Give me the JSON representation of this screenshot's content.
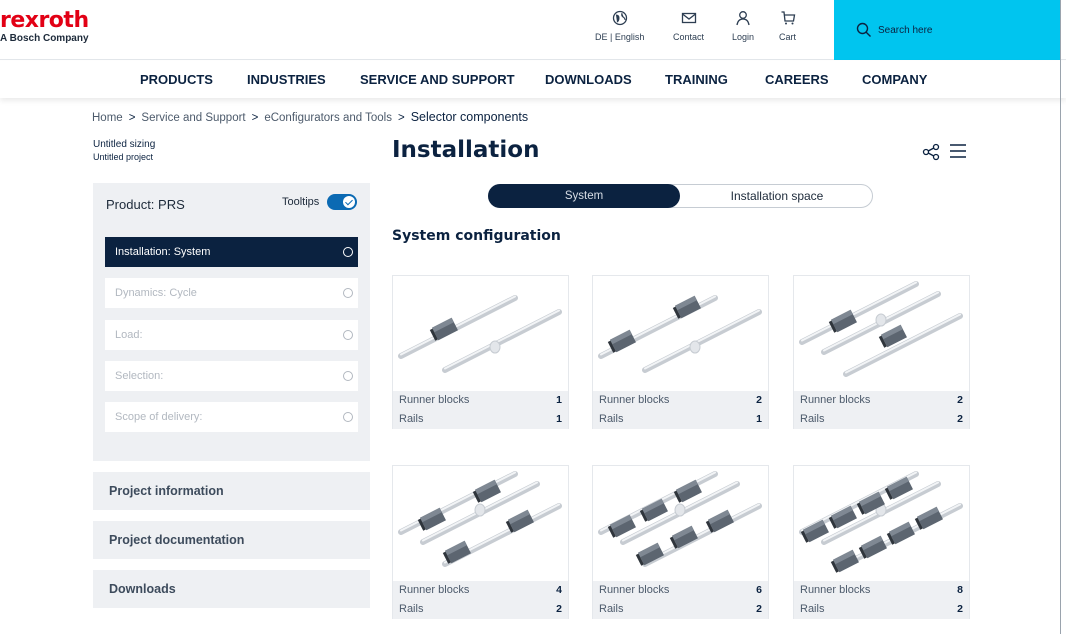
{
  "brand": {
    "logo": "rexroth",
    "tagline": "A Bosch Company"
  },
  "utility_nav": [
    {
      "label": "DE | English",
      "icon": "globe-icon"
    },
    {
      "label": "Contact",
      "icon": "envelope-icon"
    },
    {
      "label": "Login",
      "icon": "user-icon"
    },
    {
      "label": "Cart",
      "icon": "cart-icon"
    }
  ],
  "search": {
    "placeholder": "Search here"
  },
  "main_nav": [
    "PRODUCTS",
    "INDUSTRIES",
    "SERVICE AND SUPPORT",
    "DOWNLOADS",
    "TRAINING",
    "CAREERS",
    "COMPANY"
  ],
  "breadcrumb": [
    "Home",
    "Service and Support",
    "eConfigurators and Tools",
    "Selector components"
  ],
  "sizing": {
    "name": "Untitled sizing",
    "project": "Untitled project"
  },
  "page_title": "Installation",
  "panel": {
    "product": "Product: PRS",
    "tooltips_label": "Tooltips",
    "tooltips_on": true,
    "steps": [
      {
        "label": "Installation:  System",
        "active": true
      },
      {
        "label": "Dynamics:  Cycle",
        "active": false
      },
      {
        "label": "Load:",
        "active": false
      },
      {
        "label": "Selection:",
        "active": false
      },
      {
        "label": "Scope of delivery:",
        "active": false
      }
    ]
  },
  "accordions": [
    "Project information",
    "Project documentation",
    "Downloads"
  ],
  "tabs": {
    "active": "System",
    "inactive": "Installation space"
  },
  "section_title": "System configuration",
  "configs": [
    {
      "runner_label": "Runner blocks",
      "runner_blocks": "1",
      "rails_label": "Rails",
      "rails": "1"
    },
    {
      "runner_label": "Runner blocks",
      "runner_blocks": "2",
      "rails_label": "Rails",
      "rails": "1"
    },
    {
      "runner_label": "Runner blocks",
      "runner_blocks": "2",
      "rails_label": "Rails",
      "rails": "2"
    },
    {
      "runner_label": "Runner blocks",
      "runner_blocks": "4",
      "rails_label": "Rails",
      "rails": "2"
    },
    {
      "runner_label": "Runner blocks",
      "runner_blocks": "6",
      "rails_label": "Rails",
      "rails": "2"
    },
    {
      "runner_label": "Runner blocks",
      "runner_blocks": "8",
      "rails_label": "Rails",
      "rails": "2"
    }
  ],
  "colors": {
    "brand_red": "#e20015",
    "navy": "#0b2240",
    "search_cyan": "#00c5ef",
    "toggle_blue": "#0b6ab3"
  }
}
